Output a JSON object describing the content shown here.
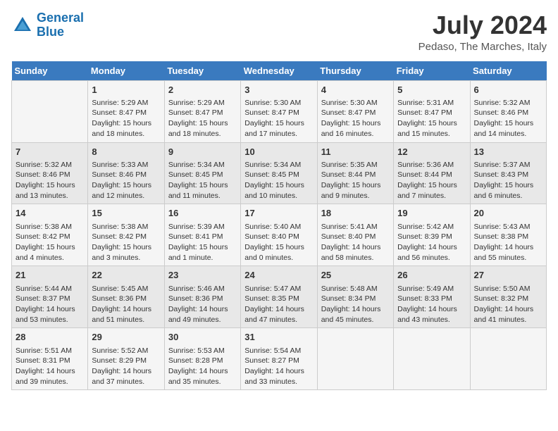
{
  "header": {
    "logo_line1": "General",
    "logo_line2": "Blue",
    "month_year": "July 2024",
    "location": "Pedaso, The Marches, Italy"
  },
  "weekdays": [
    "Sunday",
    "Monday",
    "Tuesday",
    "Wednesday",
    "Thursday",
    "Friday",
    "Saturday"
  ],
  "weeks": [
    [
      {
        "day": "",
        "info": ""
      },
      {
        "day": "1",
        "info": "Sunrise: 5:29 AM\nSunset: 8:47 PM\nDaylight: 15 hours\nand 18 minutes."
      },
      {
        "day": "2",
        "info": "Sunrise: 5:29 AM\nSunset: 8:47 PM\nDaylight: 15 hours\nand 18 minutes."
      },
      {
        "day": "3",
        "info": "Sunrise: 5:30 AM\nSunset: 8:47 PM\nDaylight: 15 hours\nand 17 minutes."
      },
      {
        "day": "4",
        "info": "Sunrise: 5:30 AM\nSunset: 8:47 PM\nDaylight: 15 hours\nand 16 minutes."
      },
      {
        "day": "5",
        "info": "Sunrise: 5:31 AM\nSunset: 8:47 PM\nDaylight: 15 hours\nand 15 minutes."
      },
      {
        "day": "6",
        "info": "Sunrise: 5:32 AM\nSunset: 8:46 PM\nDaylight: 15 hours\nand 14 minutes."
      }
    ],
    [
      {
        "day": "7",
        "info": "Sunrise: 5:32 AM\nSunset: 8:46 PM\nDaylight: 15 hours\nand 13 minutes."
      },
      {
        "day": "8",
        "info": "Sunrise: 5:33 AM\nSunset: 8:46 PM\nDaylight: 15 hours\nand 12 minutes."
      },
      {
        "day": "9",
        "info": "Sunrise: 5:34 AM\nSunset: 8:45 PM\nDaylight: 15 hours\nand 11 minutes."
      },
      {
        "day": "10",
        "info": "Sunrise: 5:34 AM\nSunset: 8:45 PM\nDaylight: 15 hours\nand 10 minutes."
      },
      {
        "day": "11",
        "info": "Sunrise: 5:35 AM\nSunset: 8:44 PM\nDaylight: 15 hours\nand 9 minutes."
      },
      {
        "day": "12",
        "info": "Sunrise: 5:36 AM\nSunset: 8:44 PM\nDaylight: 15 hours\nand 7 minutes."
      },
      {
        "day": "13",
        "info": "Sunrise: 5:37 AM\nSunset: 8:43 PM\nDaylight: 15 hours\nand 6 minutes."
      }
    ],
    [
      {
        "day": "14",
        "info": "Sunrise: 5:38 AM\nSunset: 8:42 PM\nDaylight: 15 hours\nand 4 minutes."
      },
      {
        "day": "15",
        "info": "Sunrise: 5:38 AM\nSunset: 8:42 PM\nDaylight: 15 hours\nand 3 minutes."
      },
      {
        "day": "16",
        "info": "Sunrise: 5:39 AM\nSunset: 8:41 PM\nDaylight: 15 hours\nand 1 minute."
      },
      {
        "day": "17",
        "info": "Sunrise: 5:40 AM\nSunset: 8:40 PM\nDaylight: 15 hours\nand 0 minutes."
      },
      {
        "day": "18",
        "info": "Sunrise: 5:41 AM\nSunset: 8:40 PM\nDaylight: 14 hours\nand 58 minutes."
      },
      {
        "day": "19",
        "info": "Sunrise: 5:42 AM\nSunset: 8:39 PM\nDaylight: 14 hours\nand 56 minutes."
      },
      {
        "day": "20",
        "info": "Sunrise: 5:43 AM\nSunset: 8:38 PM\nDaylight: 14 hours\nand 55 minutes."
      }
    ],
    [
      {
        "day": "21",
        "info": "Sunrise: 5:44 AM\nSunset: 8:37 PM\nDaylight: 14 hours\nand 53 minutes."
      },
      {
        "day": "22",
        "info": "Sunrise: 5:45 AM\nSunset: 8:36 PM\nDaylight: 14 hours\nand 51 minutes."
      },
      {
        "day": "23",
        "info": "Sunrise: 5:46 AM\nSunset: 8:36 PM\nDaylight: 14 hours\nand 49 minutes."
      },
      {
        "day": "24",
        "info": "Sunrise: 5:47 AM\nSunset: 8:35 PM\nDaylight: 14 hours\nand 47 minutes."
      },
      {
        "day": "25",
        "info": "Sunrise: 5:48 AM\nSunset: 8:34 PM\nDaylight: 14 hours\nand 45 minutes."
      },
      {
        "day": "26",
        "info": "Sunrise: 5:49 AM\nSunset: 8:33 PM\nDaylight: 14 hours\nand 43 minutes."
      },
      {
        "day": "27",
        "info": "Sunrise: 5:50 AM\nSunset: 8:32 PM\nDaylight: 14 hours\nand 41 minutes."
      }
    ],
    [
      {
        "day": "28",
        "info": "Sunrise: 5:51 AM\nSunset: 8:31 PM\nDaylight: 14 hours\nand 39 minutes."
      },
      {
        "day": "29",
        "info": "Sunrise: 5:52 AM\nSunset: 8:29 PM\nDaylight: 14 hours\nand 37 minutes."
      },
      {
        "day": "30",
        "info": "Sunrise: 5:53 AM\nSunset: 8:28 PM\nDaylight: 14 hours\nand 35 minutes."
      },
      {
        "day": "31",
        "info": "Sunrise: 5:54 AM\nSunset: 8:27 PM\nDaylight: 14 hours\nand 33 minutes."
      },
      {
        "day": "",
        "info": ""
      },
      {
        "day": "",
        "info": ""
      },
      {
        "day": "",
        "info": ""
      }
    ]
  ]
}
